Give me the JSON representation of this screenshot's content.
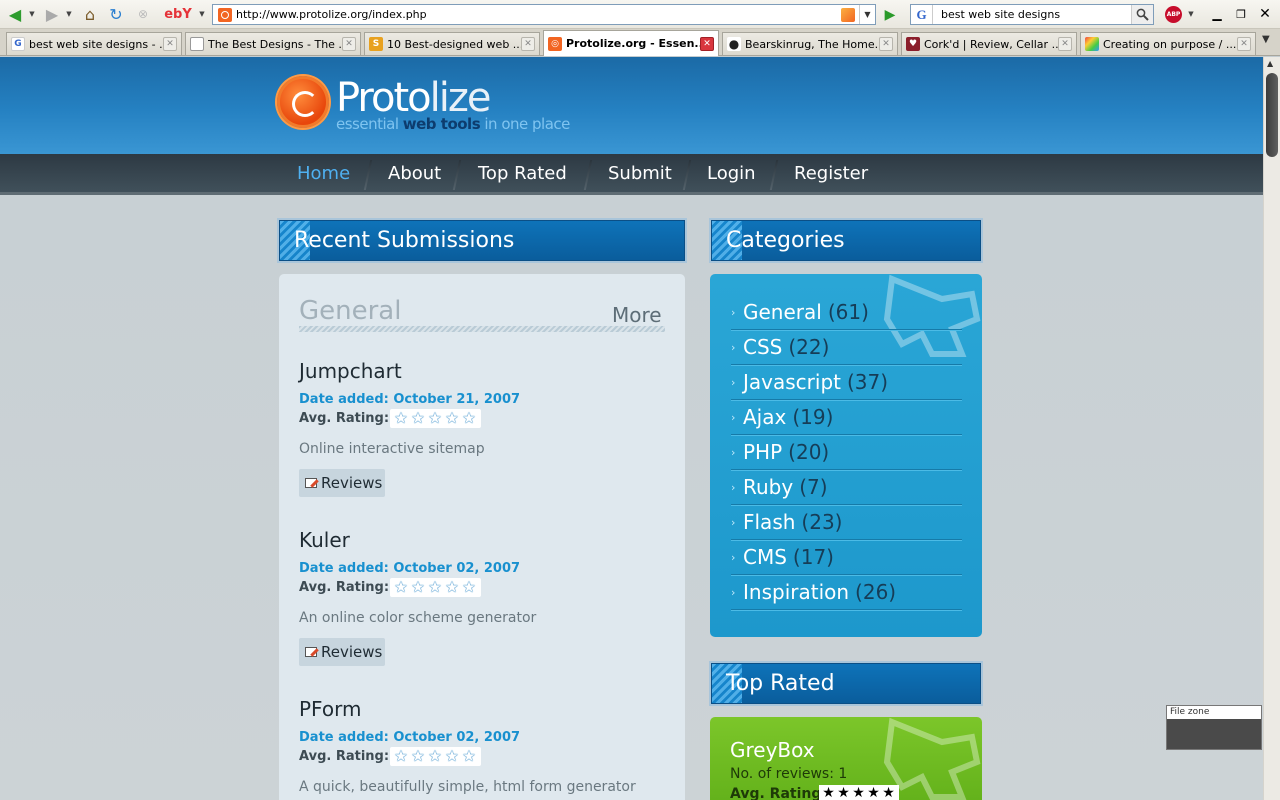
{
  "browser": {
    "url": "http://www.protolize.org/index.php",
    "search_query": "best web site designs",
    "ebay_label": "ebY",
    "abp_label": "ABP",
    "tabs": [
      {
        "title": "best web site designs - ...",
        "icon": "google-icon",
        "color": "#3366cc"
      },
      {
        "title": "The Best Designs - The ...",
        "icon": "page-icon",
        "color": "#ffffff"
      },
      {
        "title": "10 Best-designed web ...",
        "icon": "s-icon",
        "color": "#e8a11f"
      },
      {
        "title": "Protolize.org - Essen...",
        "icon": "protolize-icon",
        "color": "#f26522",
        "active": true
      },
      {
        "title": "Bearskinrug, The Home...",
        "icon": "bear-icon",
        "color": "#222222"
      },
      {
        "title": "Cork'd | Review, Cellar ...",
        "icon": "wine-icon",
        "color": "#8b1e2b"
      },
      {
        "title": "Creating on purpose / ...",
        "icon": "cube-icon",
        "color": "#4aa3df"
      }
    ]
  },
  "site": {
    "logo_proto": "Proto",
    "logo_lize": "lize",
    "tag_essential": "essential ",
    "tag_web_tools": "web tools",
    "tag_rest": " in one place",
    "nav": [
      "Home",
      "About",
      "Top Rated",
      "Submit",
      "Login",
      "Register"
    ],
    "recent_heading": "Recent Submissions",
    "categories_heading": "Categories",
    "top_rated_heading": "Top Rated",
    "general_title": "General",
    "more_label": "More",
    "date_label": "Date added:",
    "rating_label": "Avg. Rating:",
    "reviews_label": "Reviews",
    "submissions": [
      {
        "title": "Jumpchart",
        "date": "October 21, 2007",
        "description": "Online interactive sitemap",
        "rating": 0
      },
      {
        "title": "Kuler",
        "date": "October 02, 2007",
        "description": "An online color scheme generator",
        "rating": 0
      },
      {
        "title": "PForm",
        "date": "October 02, 2007",
        "description": "A quick, beautifully simple, html form generator",
        "rating": 0
      }
    ],
    "categories": [
      {
        "name": "General",
        "count": "(61)"
      },
      {
        "name": "CSS",
        "count": "(22)"
      },
      {
        "name": "Javascript",
        "count": "(37)"
      },
      {
        "name": "Ajax",
        "count": "(19)"
      },
      {
        "name": "PHP",
        "count": "(20)"
      },
      {
        "name": "Ruby",
        "count": "(7)"
      },
      {
        "name": "Flash",
        "count": "(23)"
      },
      {
        "name": "CMS",
        "count": "(17)"
      },
      {
        "name": "Inspiration",
        "count": "(26)"
      }
    ],
    "top_rated": {
      "name": "GreyBox",
      "reviews_label": "No. of reviews: 1",
      "rating_label": "Avg. Rating:",
      "rating": 5
    }
  },
  "file_zone": "File zone",
  "colors": {
    "header_blue": "#2581c2",
    "accent_orange": "#f26522",
    "category_blue": "#2aa6d6",
    "top_rated_green": "#7cc62a",
    "nav_active": "#4fb0f0"
  }
}
